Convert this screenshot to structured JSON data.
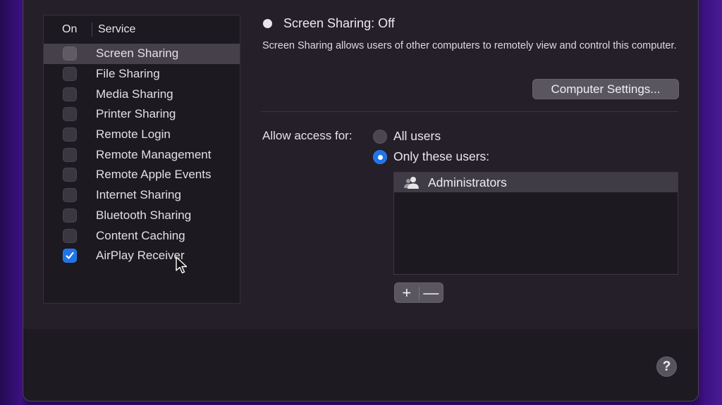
{
  "service_list": {
    "header_on": "On",
    "header_service": "Service",
    "items": [
      {
        "label": "Screen Sharing",
        "checked": false,
        "selected": true
      },
      {
        "label": "File Sharing",
        "checked": false,
        "selected": false
      },
      {
        "label": "Media Sharing",
        "checked": false,
        "selected": false
      },
      {
        "label": "Printer Sharing",
        "checked": false,
        "selected": false
      },
      {
        "label": "Remote Login",
        "checked": false,
        "selected": false
      },
      {
        "label": "Remote Management",
        "checked": false,
        "selected": false
      },
      {
        "label": "Remote Apple Events",
        "checked": false,
        "selected": false
      },
      {
        "label": "Internet Sharing",
        "checked": false,
        "selected": false
      },
      {
        "label": "Bluetooth Sharing",
        "checked": false,
        "selected": false
      },
      {
        "label": "Content Caching",
        "checked": false,
        "selected": false
      },
      {
        "label": "AirPlay Receiver",
        "checked": true,
        "selected": false
      }
    ]
  },
  "detail": {
    "status": "Screen Sharing: Off",
    "description": "Screen Sharing allows users of other computers to remotely view and control this computer.",
    "computer_settings_label": "Computer Settings...",
    "allow_access_label": "Allow access for:",
    "radio_options": [
      {
        "label": "All users",
        "selected": false
      },
      {
        "label": "Only these users:",
        "selected": true
      }
    ],
    "users": [
      {
        "name": "Administrators",
        "icon": "group-icon"
      }
    ],
    "add_label": "+",
    "remove_label": "—"
  },
  "footer": {
    "help_label": "?"
  },
  "colors": {
    "accent": "#1f74e8",
    "window_bg": "#251f29",
    "desktop": "#2a0a5a"
  }
}
